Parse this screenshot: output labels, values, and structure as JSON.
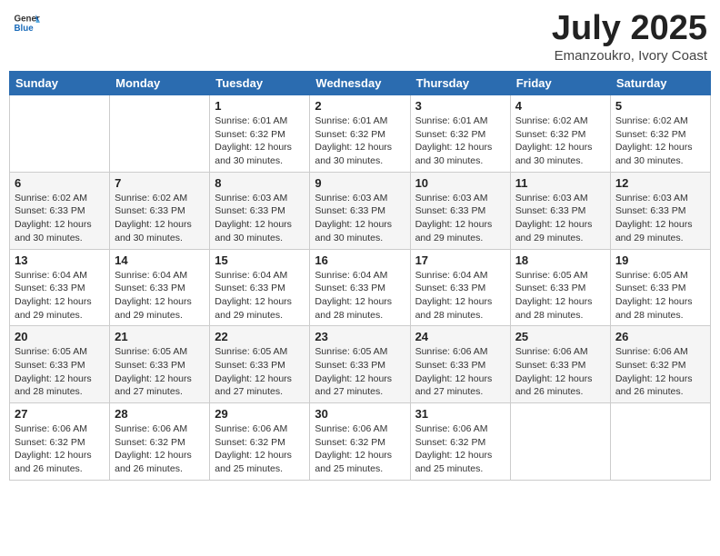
{
  "header": {
    "logo_general": "General",
    "logo_blue": "Blue",
    "month_title": "July 2025",
    "subtitle": "Emanzoukro, Ivory Coast"
  },
  "days_of_week": [
    "Sunday",
    "Monday",
    "Tuesday",
    "Wednesday",
    "Thursday",
    "Friday",
    "Saturday"
  ],
  "weeks": [
    [
      {
        "day": "",
        "info": ""
      },
      {
        "day": "",
        "info": ""
      },
      {
        "day": "1",
        "info": "Sunrise: 6:01 AM\nSunset: 6:32 PM\nDaylight: 12 hours and 30 minutes."
      },
      {
        "day": "2",
        "info": "Sunrise: 6:01 AM\nSunset: 6:32 PM\nDaylight: 12 hours and 30 minutes."
      },
      {
        "day": "3",
        "info": "Sunrise: 6:01 AM\nSunset: 6:32 PM\nDaylight: 12 hours and 30 minutes."
      },
      {
        "day": "4",
        "info": "Sunrise: 6:02 AM\nSunset: 6:32 PM\nDaylight: 12 hours and 30 minutes."
      },
      {
        "day": "5",
        "info": "Sunrise: 6:02 AM\nSunset: 6:32 PM\nDaylight: 12 hours and 30 minutes."
      }
    ],
    [
      {
        "day": "6",
        "info": "Sunrise: 6:02 AM\nSunset: 6:33 PM\nDaylight: 12 hours and 30 minutes."
      },
      {
        "day": "7",
        "info": "Sunrise: 6:02 AM\nSunset: 6:33 PM\nDaylight: 12 hours and 30 minutes."
      },
      {
        "day": "8",
        "info": "Sunrise: 6:03 AM\nSunset: 6:33 PM\nDaylight: 12 hours and 30 minutes."
      },
      {
        "day": "9",
        "info": "Sunrise: 6:03 AM\nSunset: 6:33 PM\nDaylight: 12 hours and 30 minutes."
      },
      {
        "day": "10",
        "info": "Sunrise: 6:03 AM\nSunset: 6:33 PM\nDaylight: 12 hours and 29 minutes."
      },
      {
        "day": "11",
        "info": "Sunrise: 6:03 AM\nSunset: 6:33 PM\nDaylight: 12 hours and 29 minutes."
      },
      {
        "day": "12",
        "info": "Sunrise: 6:03 AM\nSunset: 6:33 PM\nDaylight: 12 hours and 29 minutes."
      }
    ],
    [
      {
        "day": "13",
        "info": "Sunrise: 6:04 AM\nSunset: 6:33 PM\nDaylight: 12 hours and 29 minutes."
      },
      {
        "day": "14",
        "info": "Sunrise: 6:04 AM\nSunset: 6:33 PM\nDaylight: 12 hours and 29 minutes."
      },
      {
        "day": "15",
        "info": "Sunrise: 6:04 AM\nSunset: 6:33 PM\nDaylight: 12 hours and 29 minutes."
      },
      {
        "day": "16",
        "info": "Sunrise: 6:04 AM\nSunset: 6:33 PM\nDaylight: 12 hours and 28 minutes."
      },
      {
        "day": "17",
        "info": "Sunrise: 6:04 AM\nSunset: 6:33 PM\nDaylight: 12 hours and 28 minutes."
      },
      {
        "day": "18",
        "info": "Sunrise: 6:05 AM\nSunset: 6:33 PM\nDaylight: 12 hours and 28 minutes."
      },
      {
        "day": "19",
        "info": "Sunrise: 6:05 AM\nSunset: 6:33 PM\nDaylight: 12 hours and 28 minutes."
      }
    ],
    [
      {
        "day": "20",
        "info": "Sunrise: 6:05 AM\nSunset: 6:33 PM\nDaylight: 12 hours and 28 minutes."
      },
      {
        "day": "21",
        "info": "Sunrise: 6:05 AM\nSunset: 6:33 PM\nDaylight: 12 hours and 27 minutes."
      },
      {
        "day": "22",
        "info": "Sunrise: 6:05 AM\nSunset: 6:33 PM\nDaylight: 12 hours and 27 minutes."
      },
      {
        "day": "23",
        "info": "Sunrise: 6:05 AM\nSunset: 6:33 PM\nDaylight: 12 hours and 27 minutes."
      },
      {
        "day": "24",
        "info": "Sunrise: 6:06 AM\nSunset: 6:33 PM\nDaylight: 12 hours and 27 minutes."
      },
      {
        "day": "25",
        "info": "Sunrise: 6:06 AM\nSunset: 6:33 PM\nDaylight: 12 hours and 26 minutes."
      },
      {
        "day": "26",
        "info": "Sunrise: 6:06 AM\nSunset: 6:32 PM\nDaylight: 12 hours and 26 minutes."
      }
    ],
    [
      {
        "day": "27",
        "info": "Sunrise: 6:06 AM\nSunset: 6:32 PM\nDaylight: 12 hours and 26 minutes."
      },
      {
        "day": "28",
        "info": "Sunrise: 6:06 AM\nSunset: 6:32 PM\nDaylight: 12 hours and 26 minutes."
      },
      {
        "day": "29",
        "info": "Sunrise: 6:06 AM\nSunset: 6:32 PM\nDaylight: 12 hours and 25 minutes."
      },
      {
        "day": "30",
        "info": "Sunrise: 6:06 AM\nSunset: 6:32 PM\nDaylight: 12 hours and 25 minutes."
      },
      {
        "day": "31",
        "info": "Sunrise: 6:06 AM\nSunset: 6:32 PM\nDaylight: 12 hours and 25 minutes."
      },
      {
        "day": "",
        "info": ""
      },
      {
        "day": "",
        "info": ""
      }
    ]
  ]
}
